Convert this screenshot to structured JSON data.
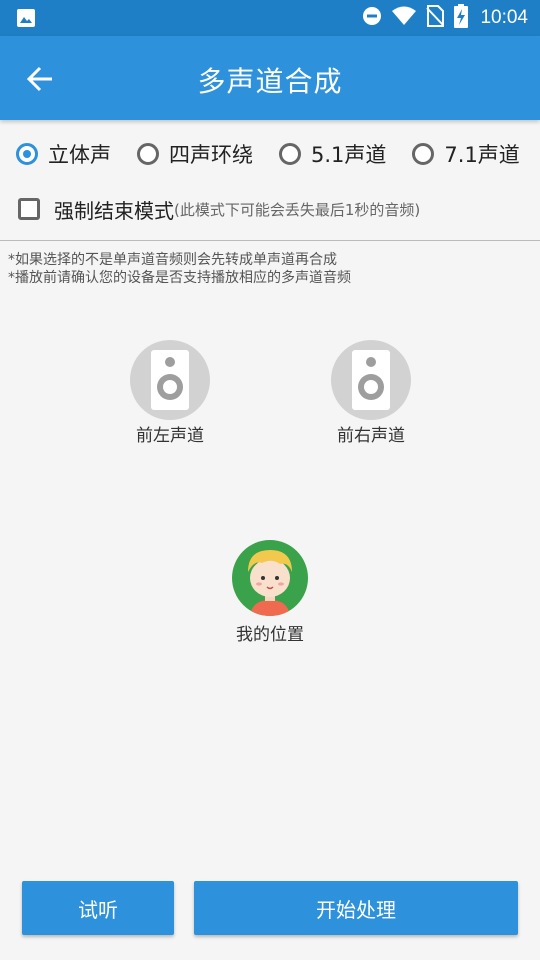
{
  "status_bar": {
    "time": "10:04",
    "icons": [
      "image-icon",
      "do-not-disturb-icon",
      "wifi-icon",
      "no-sim-icon",
      "battery-charging-icon"
    ]
  },
  "app_bar": {
    "back_icon": "arrow-back-icon",
    "title": "多声道合成"
  },
  "channel_options": [
    {
      "label": "立体声",
      "checked": true
    },
    {
      "label": "四声环绕",
      "checked": false
    },
    {
      "label": "5.1声道",
      "checked": false
    },
    {
      "label": "7.1声道",
      "checked": false
    }
  ],
  "force_end": {
    "label": "强制结束模式",
    "hint": "(此模式下可能会丢失最后1秒的音频)",
    "checked": false
  },
  "notes": [
    "*如果选择的不是单声道音频则会先转成单声道再合成",
    "*播放前请确认您的设备是否支持播放相应的多声道音频"
  ],
  "speakers": {
    "front_left": "前左声道",
    "front_right": "前右声道",
    "my_position": "我的位置"
  },
  "buttons": {
    "preview": "试听",
    "start": "开始处理"
  },
  "colors": {
    "status_bar": "#1f7fc6",
    "app_bar": "#2d91db",
    "accent": "#2d91db",
    "avatar_bg": "#3aa24a"
  }
}
